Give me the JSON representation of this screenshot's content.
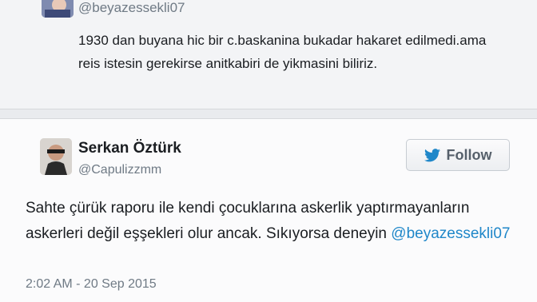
{
  "tweet1": {
    "handle": "@beyazessekli07",
    "text": "1930 dan buyana hic bir c.baskanina bukadar hakaret edilmedi.ama reis istesin gerekirse anitkabiri de yikmasini biliriz."
  },
  "tweet2": {
    "name": "Serkan Öztürk",
    "handle": "@Capulizzmm",
    "follow_label": "Follow",
    "text_before": "Sahte çürük raporu ile kendi çocuklarına askerlik yaptırmayanların askerleri değil eşşekleri olur ancak. Sıkıyorsa deneyin ",
    "mention": "@beyazessekli07",
    "timestamp": "2:02 AM - 20 Sep 2015"
  },
  "colors": {
    "link": "#1f87c9",
    "twitter_bird": "#1f87c9"
  },
  "icons": {
    "follow_icon": "twitter-bird-icon"
  }
}
